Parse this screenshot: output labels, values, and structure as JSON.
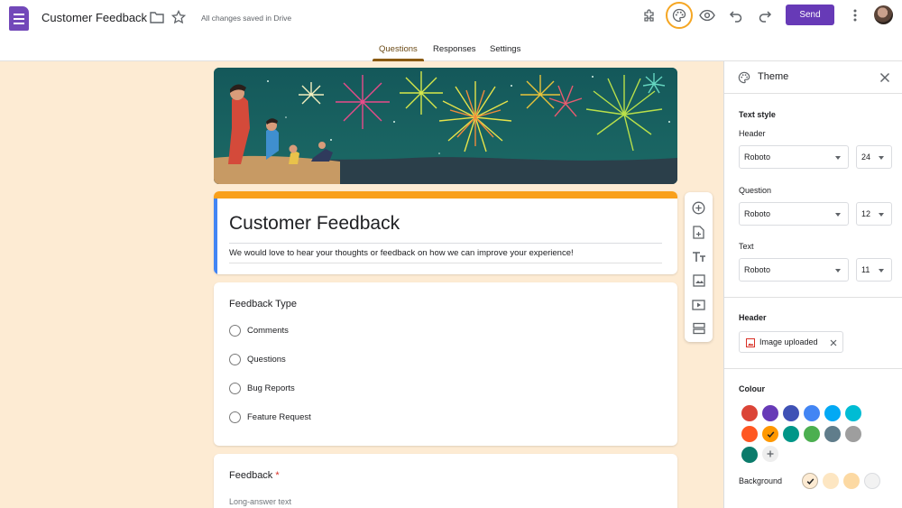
{
  "header": {
    "doc_title": "Customer Feedback",
    "save_status": "All changes saved in Drive",
    "send_label": "Send",
    "icons": [
      "forms-app-icon",
      "folder-icon",
      "star-icon",
      "addon-puzzle-icon",
      "palette-icon",
      "preview-eye-icon",
      "undo-icon",
      "redo-icon",
      "more-vert-icon"
    ]
  },
  "tabs": [
    {
      "label": "Questions",
      "active": true
    },
    {
      "label": "Responses",
      "active": false
    },
    {
      "label": "Settings",
      "active": false
    }
  ],
  "form": {
    "title": "Customer Feedback",
    "description": "We would love to hear your thoughts or feedback on how we can improve your experience!"
  },
  "questions": [
    {
      "title": "Feedback Type",
      "options": [
        "Comments",
        "Questions",
        "Bug Reports",
        "Feature Request"
      ]
    },
    {
      "title": "Feedback",
      "required_mark": "*",
      "hint": "Long-answer text"
    }
  ],
  "toolbar_icons": [
    "add-question-icon",
    "import-questions-icon",
    "add-title-icon",
    "add-image-icon",
    "add-video-icon",
    "add-section-icon"
  ],
  "theme_panel": {
    "title": "Theme",
    "text_style_label": "Text style",
    "header_label": "Header",
    "header_font": "Roboto",
    "header_size": "24",
    "question_label": "Question",
    "question_font": "Roboto",
    "question_size": "12",
    "text_label": "Text",
    "text_font": "Roboto",
    "text_size": "11",
    "header_section_label": "Header",
    "image_chip_label": "Image uploaded",
    "colour_label": "Colour",
    "background_label": "Background",
    "colours": [
      "#db4437",
      "#673ab7",
      "#3f51b5",
      "#4285f4",
      "#03a9f4",
      "#00bcd4",
      "#ff5722",
      "#ff9800",
      "#009688",
      "#4caf50",
      "#607d8b",
      "#9e9e9e",
      "#0b7b6b"
    ],
    "selected_colour": "#ff9800",
    "backgrounds": [
      "#fdebd3",
      "#fde6c2",
      "#fcd9a3",
      "#f2f2f2"
    ],
    "selected_background": "#fdebd3"
  }
}
